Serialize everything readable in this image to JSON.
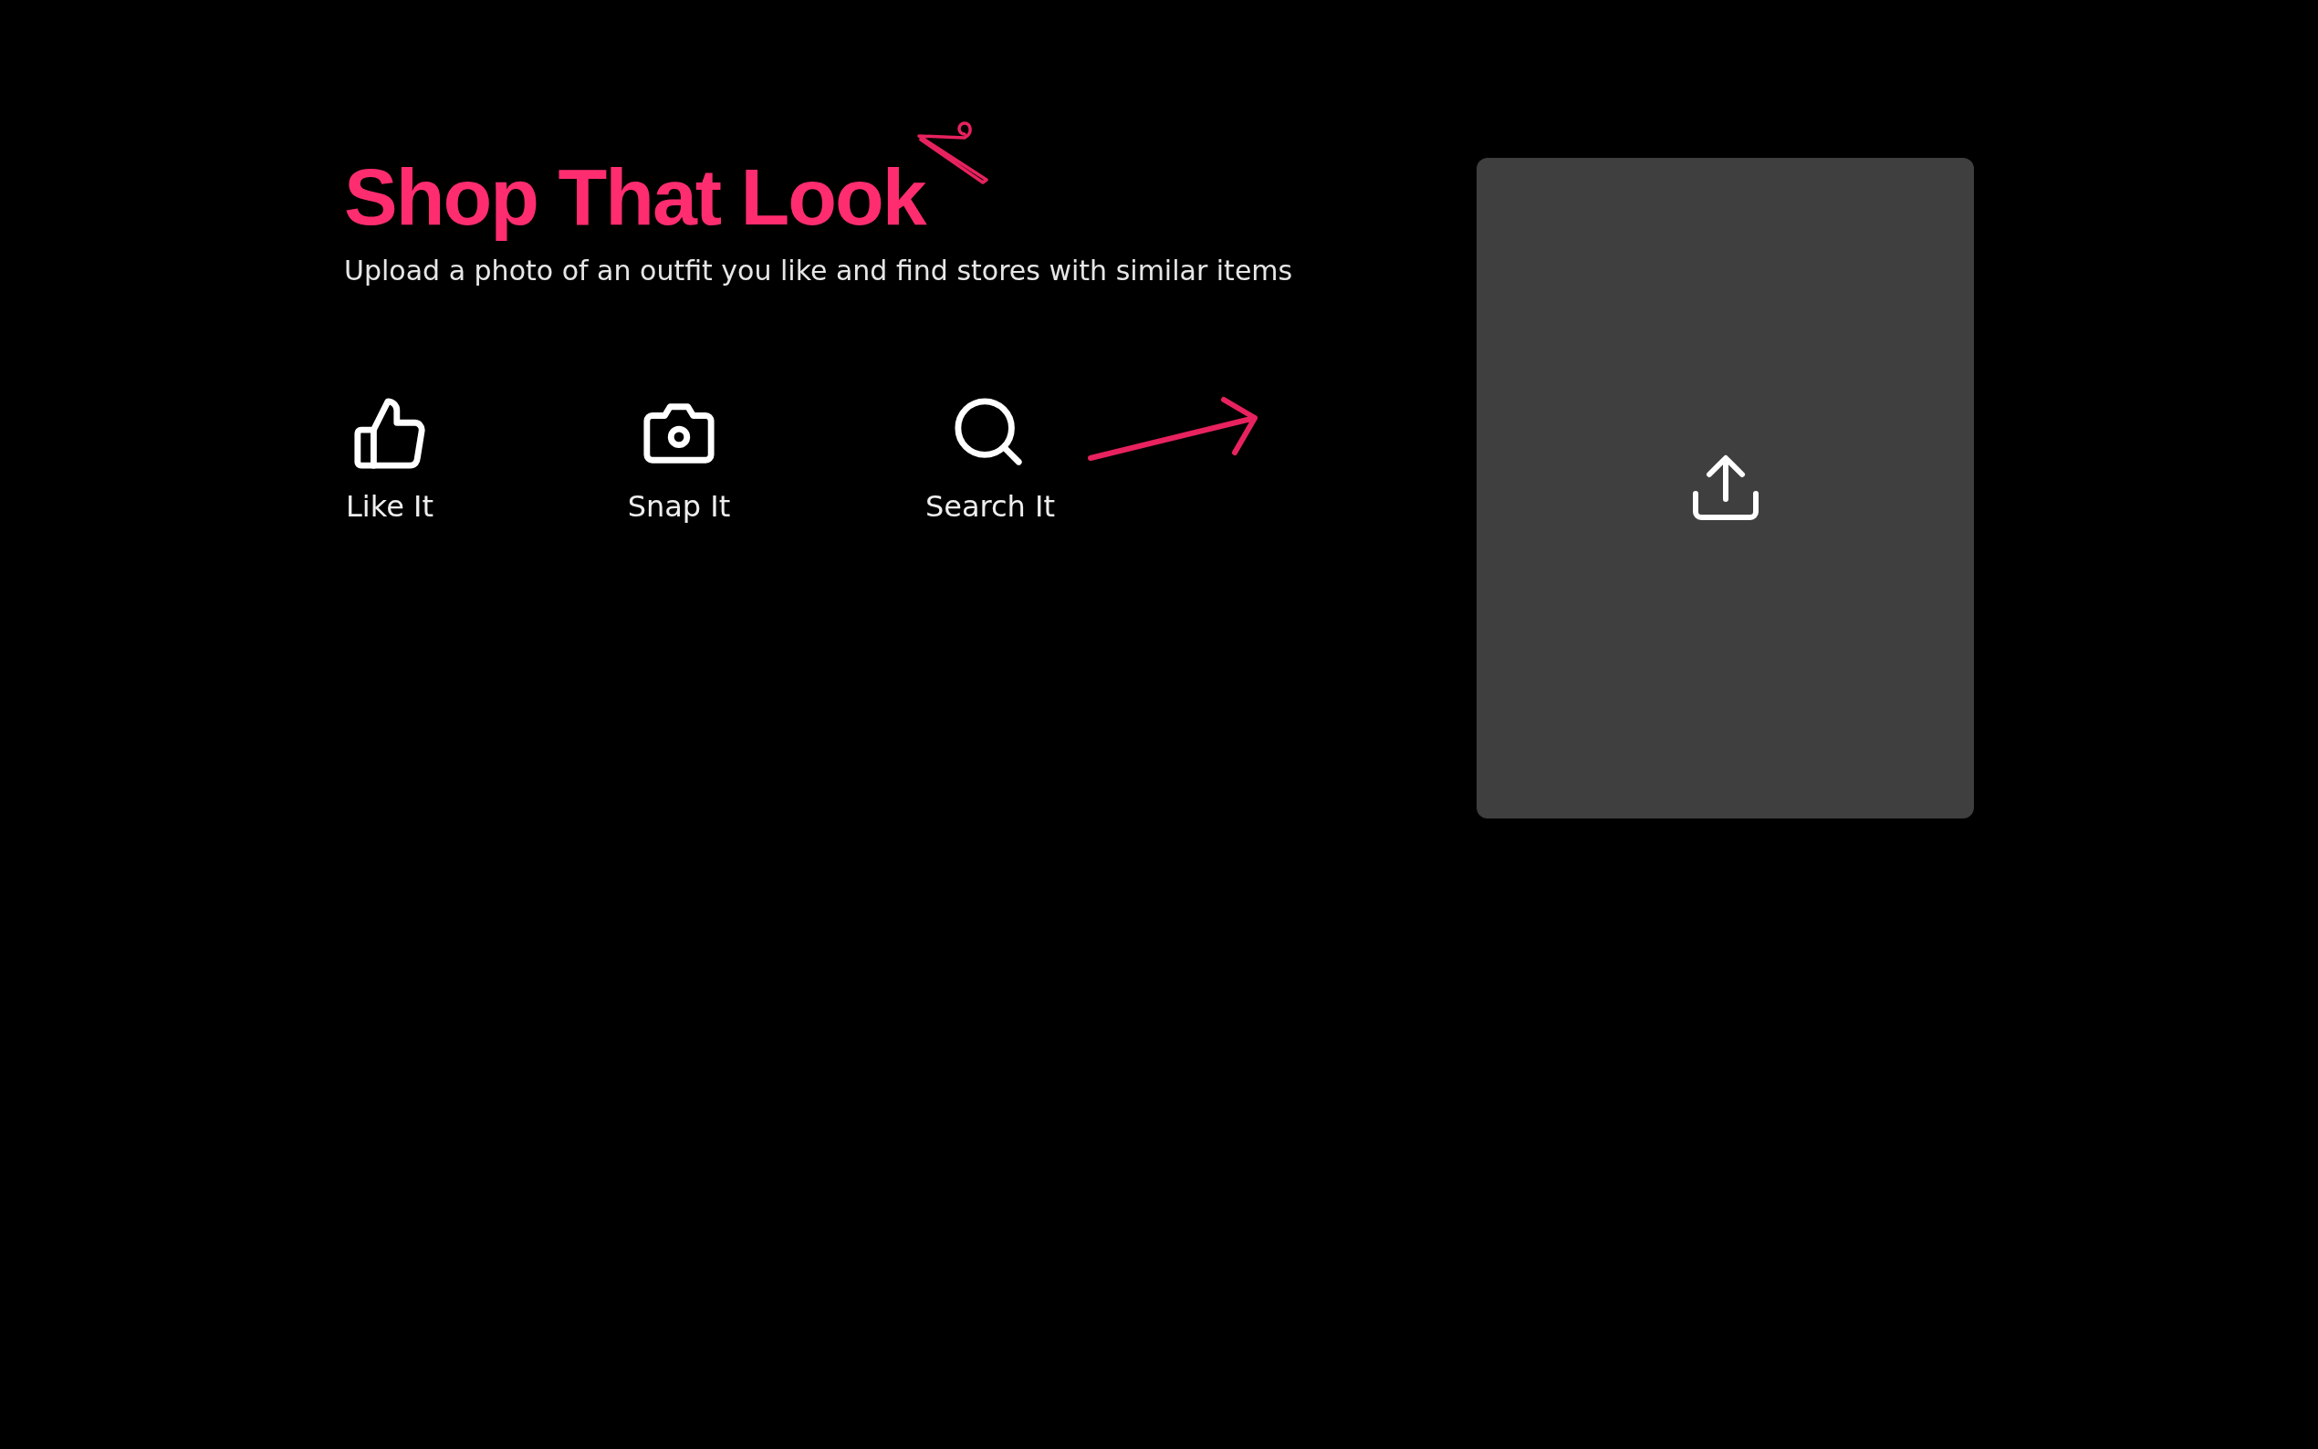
{
  "header": {
    "title": "Shop That Look",
    "subtitle": "Upload a photo of an outfit you like and find stores with similar items"
  },
  "steps": [
    {
      "kind": "thumb",
      "label": "Like It"
    },
    {
      "kind": "camera",
      "label": "Snap It"
    },
    {
      "kind": "search",
      "label": "Search It"
    }
  ]
}
